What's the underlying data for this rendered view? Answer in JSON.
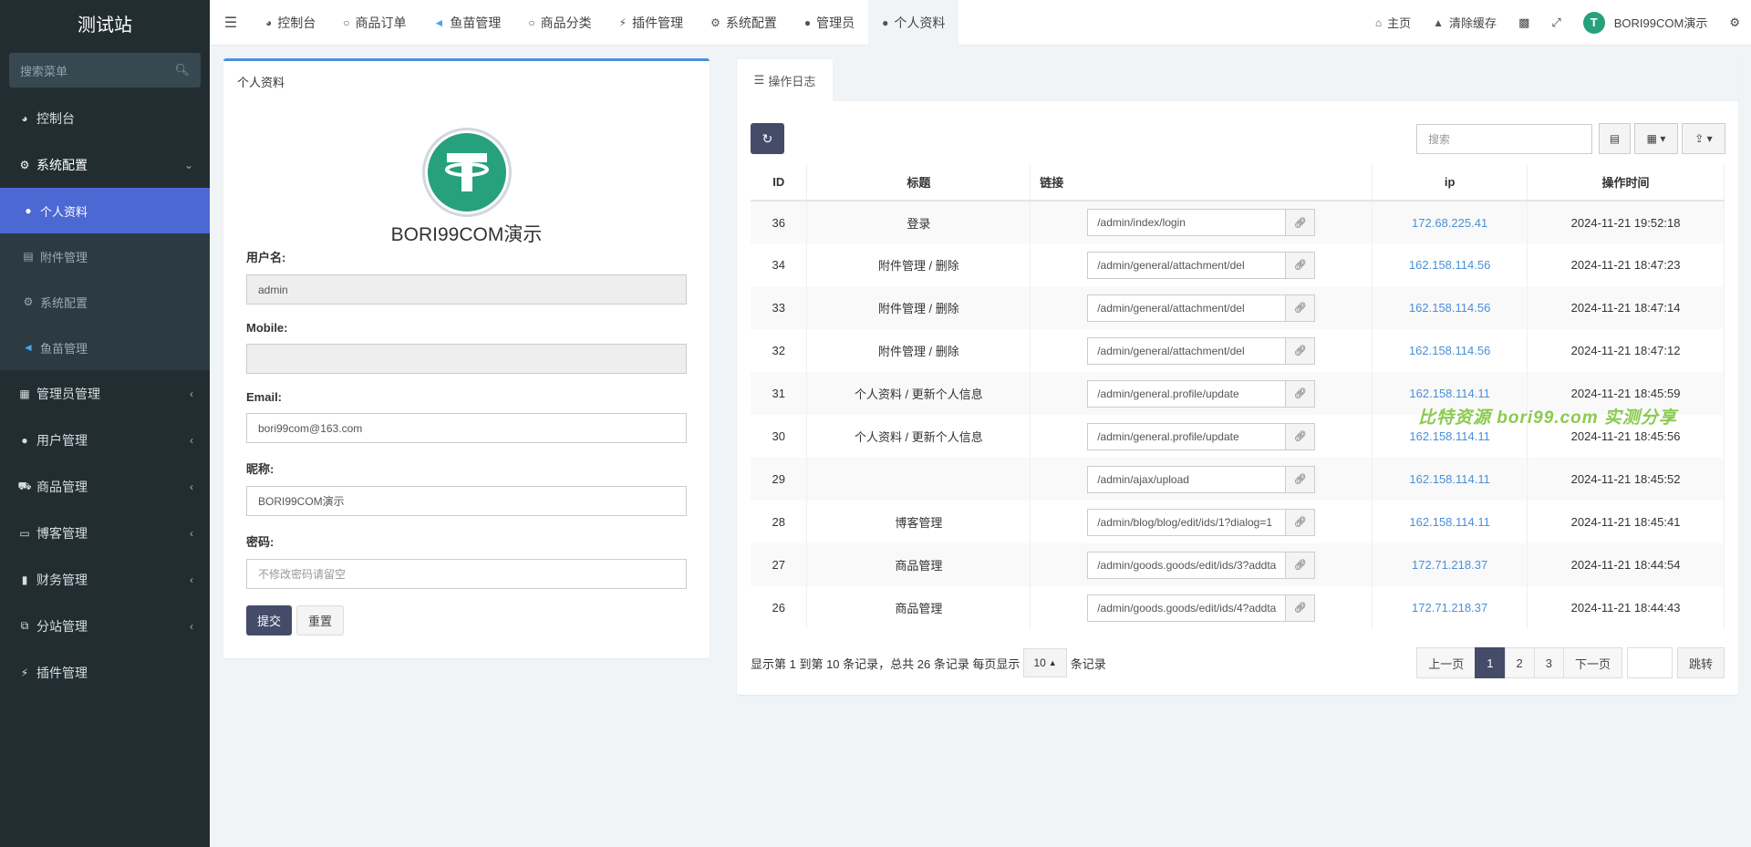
{
  "brand": "测试站",
  "sidebar": {
    "search_placeholder": "搜索菜单",
    "items": [
      {
        "label": "控制台"
      },
      {
        "label": "系统配置"
      },
      {
        "label": "个人资料"
      },
      {
        "label": "附件管理"
      },
      {
        "label": "系统配置"
      },
      {
        "label": "鱼苗管理"
      },
      {
        "label": "管理员管理"
      },
      {
        "label": "用户管理"
      },
      {
        "label": "商品管理"
      },
      {
        "label": "博客管理"
      },
      {
        "label": "财务管理"
      },
      {
        "label": "分站管理"
      },
      {
        "label": "插件管理"
      }
    ]
  },
  "topbar": {
    "tabs": [
      "控制台",
      "商品订单",
      "鱼苗管理",
      "商品分类",
      "插件管理",
      "系统配置",
      "管理员",
      "个人资料"
    ],
    "home": "主页",
    "clear_cache": "清除缓存",
    "user": "BORI99COM演示"
  },
  "profile": {
    "panel_title": "个人资料",
    "display_name": "BORI99COM演示",
    "fields": {
      "username_label": "用户名:",
      "username_value": "admin",
      "mobile_label": "Mobile:",
      "mobile_value": "",
      "email_label": "Email:",
      "email_value": "bori99com@163.com",
      "nickname_label": "昵称:",
      "nickname_value": "BORI99COM演示",
      "password_label": "密码:",
      "password_placeholder": "不修改密码请留空"
    },
    "submit": "提交",
    "reset": "重置"
  },
  "log": {
    "tab": "操作日志",
    "search_placeholder": "搜索",
    "columns": [
      "ID",
      "标题",
      "链接",
      "ip",
      "操作时间"
    ],
    "rows": [
      {
        "id": "36",
        "title": "登录",
        "url": "/admin/index/login",
        "ip": "172.68.225.41",
        "time": "2024-11-21 19:52:18"
      },
      {
        "id": "34",
        "title": "附件管理 / 删除",
        "url": "/admin/general/attachment/del",
        "ip": "162.158.114.56",
        "time": "2024-11-21 18:47:23"
      },
      {
        "id": "33",
        "title": "附件管理 / 删除",
        "url": "/admin/general/attachment/del",
        "ip": "162.158.114.56",
        "time": "2024-11-21 18:47:14"
      },
      {
        "id": "32",
        "title": "附件管理 / 删除",
        "url": "/admin/general/attachment/del",
        "ip": "162.158.114.56",
        "time": "2024-11-21 18:47:12"
      },
      {
        "id": "31",
        "title": "个人资料 / 更新个人信息",
        "url": "/admin/general.profile/update",
        "ip": "162.158.114.11",
        "time": "2024-11-21 18:45:59"
      },
      {
        "id": "30",
        "title": "个人资料 / 更新个人信息",
        "url": "/admin/general.profile/update",
        "ip": "162.158.114.11",
        "time": "2024-11-21 18:45:56"
      },
      {
        "id": "29",
        "title": "",
        "url": "/admin/ajax/upload",
        "ip": "162.158.114.11",
        "time": "2024-11-21 18:45:52"
      },
      {
        "id": "28",
        "title": "博客管理",
        "url": "/admin/blog/blog/edit/ids/1?dialog=1",
        "ip": "162.158.114.11",
        "time": "2024-11-21 18:45:41"
      },
      {
        "id": "27",
        "title": "商品管理",
        "url": "/admin/goods.goods/edit/ids/3?addta",
        "ip": "172.71.218.37",
        "time": "2024-11-21 18:44:54"
      },
      {
        "id": "26",
        "title": "商品管理",
        "url": "/admin/goods.goods/edit/ids/4?addta",
        "ip": "172.71.218.37",
        "time": "2024-11-21 18:44:43"
      }
    ],
    "pager": {
      "info_prefix": "显示第 1 到第 10 条记录，总共 26 条记录 每页显示",
      "page_size": "10",
      "info_suffix": "条记录",
      "prev": "上一页",
      "pages": [
        "1",
        "2",
        "3"
      ],
      "next": "下一页",
      "go": "跳转"
    }
  },
  "watermark": "比特资源 bori99.com 实测分享"
}
